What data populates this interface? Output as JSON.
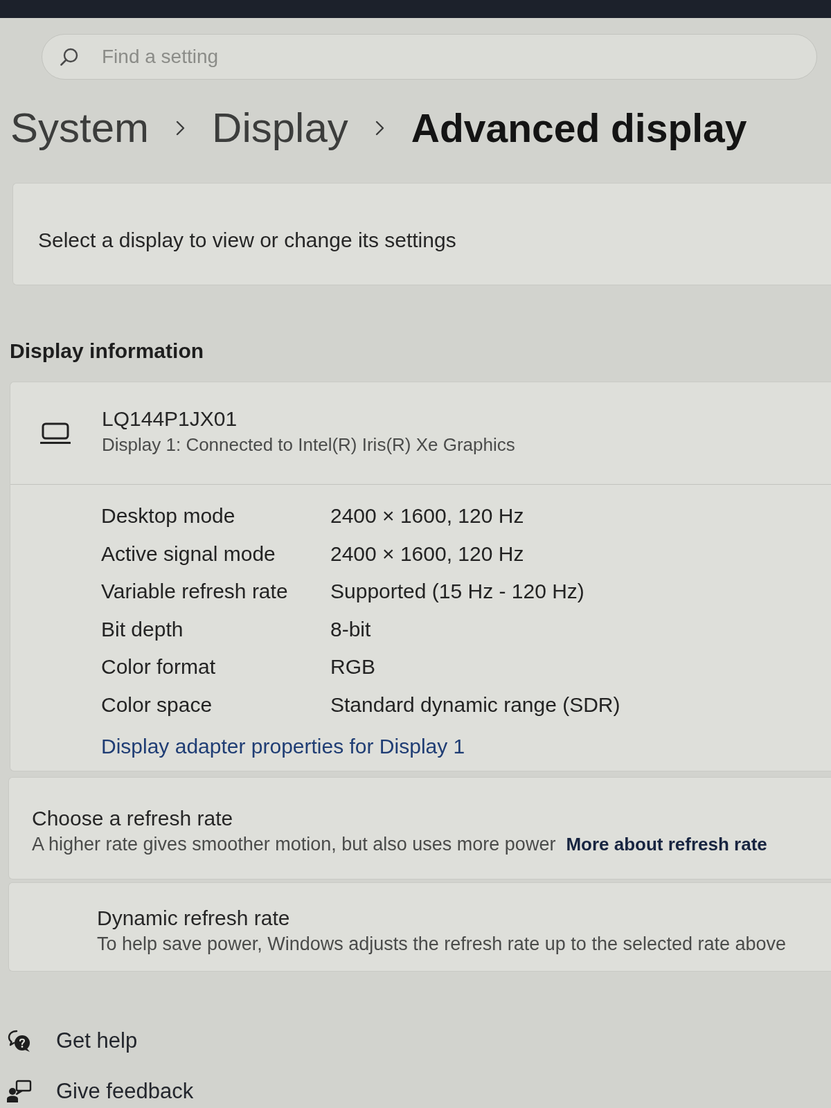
{
  "search": {
    "placeholder": "Find a setting"
  },
  "breadcrumb": [
    {
      "label": "System",
      "current": false
    },
    {
      "label": "Display",
      "current": false
    },
    {
      "label": "Advanced display",
      "current": true
    }
  ],
  "display_select": {
    "text": "Select a display to view or change its settings"
  },
  "display_information": {
    "heading": "Display information",
    "display": {
      "name": "LQ144P1JX01",
      "description": "Display 1: Connected to Intel(R) Iris(R) Xe Graphics"
    },
    "properties": [
      {
        "label": "Desktop mode",
        "value": "2400 × 1600, 120 Hz"
      },
      {
        "label": "Active signal mode",
        "value": "2400 × 1600, 120 Hz"
      },
      {
        "label": "Variable refresh rate",
        "value": "Supported (15 Hz - 120 Hz)"
      },
      {
        "label": "Bit depth",
        "value": "8-bit"
      },
      {
        "label": "Color format",
        "value": "RGB"
      },
      {
        "label": "Color space",
        "value": "Standard dynamic range (SDR)"
      }
    ],
    "link": "Display adapter properties for Display 1"
  },
  "refresh_rate": {
    "title": "Choose a refresh rate",
    "description": "A higher rate gives smoother motion, but also uses more power",
    "link": "More about refresh rate"
  },
  "dynamic_refresh_rate": {
    "title": "Dynamic refresh rate",
    "description": "To help save power, Windows adjusts the refresh rate up to the selected rate above"
  },
  "footer_links": [
    {
      "kind": "help",
      "label": "Get help"
    },
    {
      "kind": "feedback",
      "label": "Give feedback"
    }
  ]
}
